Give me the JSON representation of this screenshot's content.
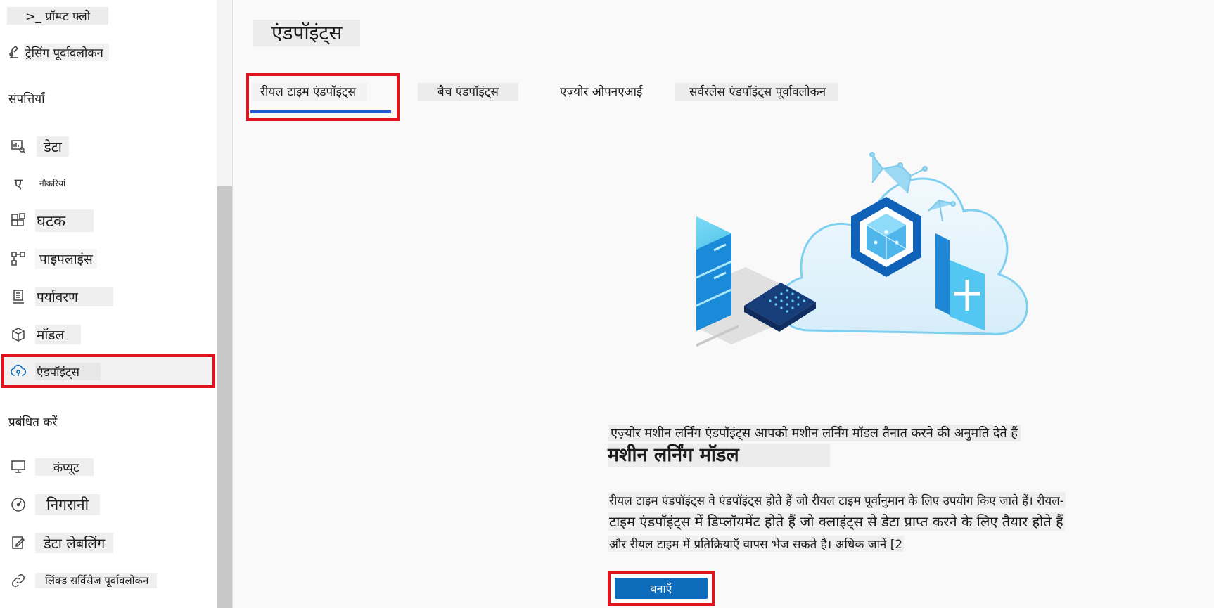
{
  "sidebar": {
    "items": [
      {
        "label": ">_ प्रॉम्प्ट फ्लो",
        "icon": "prompt-flow-icon"
      },
      {
        "label": "ट्रेसिंग पूर्वावलोकन",
        "icon": "tracing-icon"
      },
      {
        "label": "डेटा",
        "icon": "data-icon"
      },
      {
        "label": "नौकरियां",
        "icon": "jobs-icon"
      },
      {
        "label": "घटक",
        "icon": "components-icon"
      },
      {
        "label": "पाइपलाइंस",
        "icon": "pipelines-icon"
      },
      {
        "label": "पर्यावरण",
        "icon": "environments-icon"
      },
      {
        "label": "मॉडल",
        "icon": "models-icon"
      },
      {
        "label": "एंडपॉइंट्स",
        "icon": "endpoints-icon"
      },
      {
        "label": "कंप्यूट",
        "icon": "compute-icon"
      },
      {
        "label": "निगरानी",
        "icon": "monitoring-icon"
      },
      {
        "label": "डेटा लेबलिंग",
        "icon": "data-labeling-icon"
      },
      {
        "label": "लिंक्ड सर्विसेज पूर्वावलोकन",
        "icon": "linked-services-icon"
      }
    ],
    "jobs_icon_glyph": "ए",
    "section_assets": "संपत्तियाँ",
    "section_manage": "प्रबंधित करें",
    "selected_item": "एंडपॉइंट्स"
  },
  "main": {
    "title": "एंडपॉइंट्स",
    "tabs": [
      {
        "label": "रीयल टाइम एंडपॉइंट्स",
        "active": true
      },
      {
        "label": "बैच एंडपॉइंट्स",
        "active": false
      },
      {
        "label": "एज़्योर ओपनएआई",
        "active": false
      },
      {
        "label": "सर्वरलेस एंडपॉइंट्स पूर्वावलोकन",
        "active": false
      }
    ],
    "subheading": "एज़्योर मशीन लर्निंग एंडपॉइंट्स आपको मशीन लर्निंग मॉडल तैनात करने की अनुमति देते हैं",
    "heading": "मशीन लर्निंग मॉडल",
    "description_lines": [
      "रीयल टाइम एंडपॉइंट्स वे एंडपॉइंट्स होते हैं जो रीयल टाइम पूर्वानुमान के लिए उपयोग किए जाते हैं। रीयल-",
      "टाइम एंडपॉइंट्स में डिप्लॉयमेंट होते हैं जो क्लाइंट्स से डेटा प्राप्त करने के लिए तैयार होते हैं",
      "और रीयल टाइम में प्रतिक्रियाएँ वापस भेज सकते हैं। अधिक जानें [2"
    ],
    "create_button": "बनाएँ"
  },
  "colors": {
    "accent": "#0f6cbd",
    "highlight": "#e1141e",
    "tab_underline": "#1e5fcf"
  }
}
